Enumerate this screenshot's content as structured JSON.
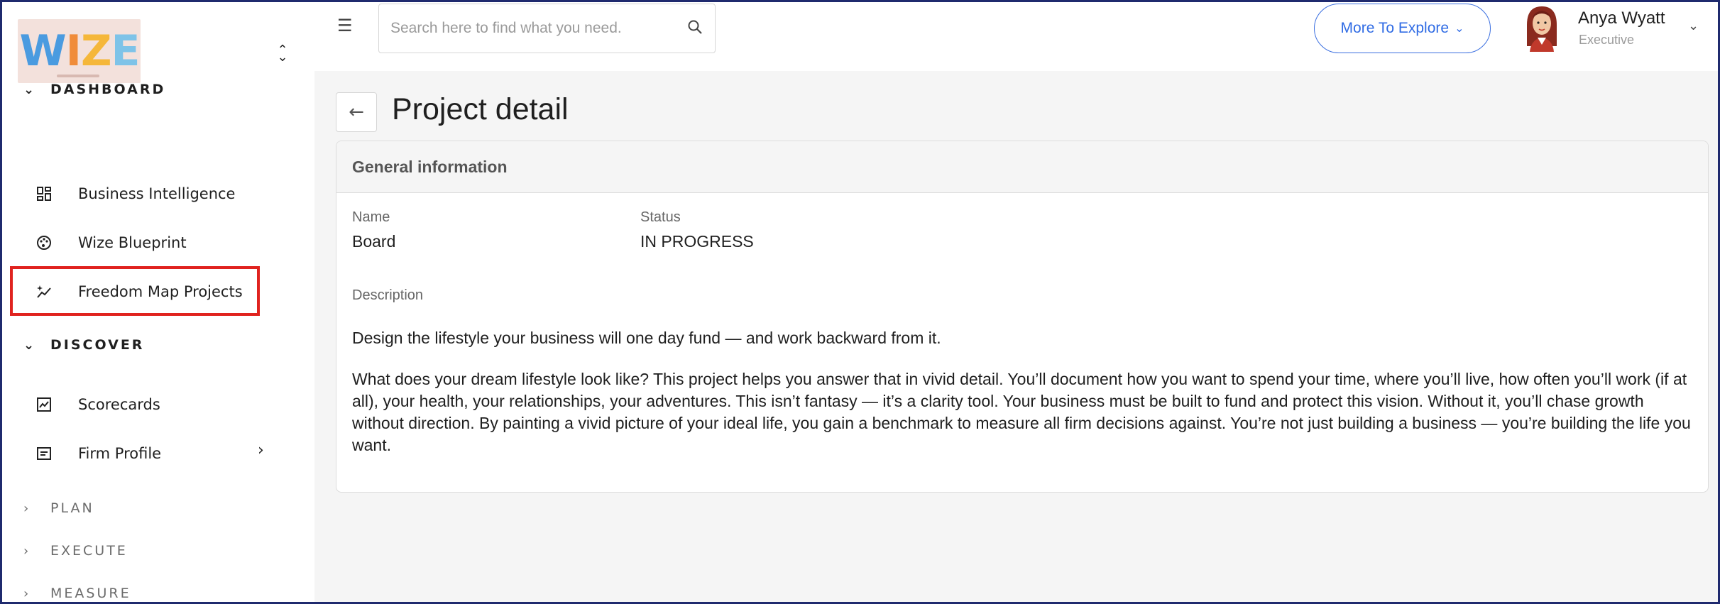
{
  "sidebar": {
    "logo_text": "WIZE",
    "sections": [
      {
        "label": "DASHBOARD",
        "expanded": true
      },
      {
        "label": "DISCOVER",
        "expanded": true
      },
      {
        "label": "PLAN",
        "expanded": false
      },
      {
        "label": "EXECUTE",
        "expanded": false
      },
      {
        "label": "MEASURE",
        "expanded": false
      }
    ],
    "dashboard_items": [
      {
        "label": "Business Intelligence",
        "icon": "dashboard-grid-icon"
      },
      {
        "label": "Wize Blueprint",
        "icon": "palette-icon"
      },
      {
        "label": "Freedom Map Projects",
        "icon": "sparkle-chart-icon",
        "highlighted": true
      }
    ],
    "discover_items": [
      {
        "label": "Scorecards",
        "icon": "chart-box-icon"
      },
      {
        "label": "Firm Profile",
        "icon": "profile-card-icon",
        "has_submenu": true
      }
    ]
  },
  "header": {
    "search_placeholder": "Search here to find what you need.",
    "explore_label": "More To Explore",
    "user": {
      "name": "Anya Wyatt",
      "role": "Executive"
    }
  },
  "page": {
    "title": "Project detail",
    "card_title": "General information",
    "fields": {
      "name_label": "Name",
      "name_value": "Board",
      "status_label": "Status",
      "status_value": "IN PROGRESS",
      "description_label": "Description"
    },
    "description": [
      "Design the lifestyle your business will one day fund — and work backward from it.",
      "What does your dream lifestyle look like? This project helps you answer that in vivid detail. You’ll document how you want to spend your time, where you’ll live, how often you’ll work (if at all), your health, your relationships, your adventures. This isn’t fantasy — it’s a clarity tool. Your business must be built to fund and protect this vision. Without it, you’ll chase growth without direction. By painting a vivid picture of your ideal life, you gain a benchmark to measure all firm decisions against. You’re not just building a business — you’re building the life you want."
    ]
  },
  "colors": {
    "accent_blue": "#2f6be4",
    "highlight_red": "#e0231f",
    "frame_navy": "#1f2a6e"
  }
}
